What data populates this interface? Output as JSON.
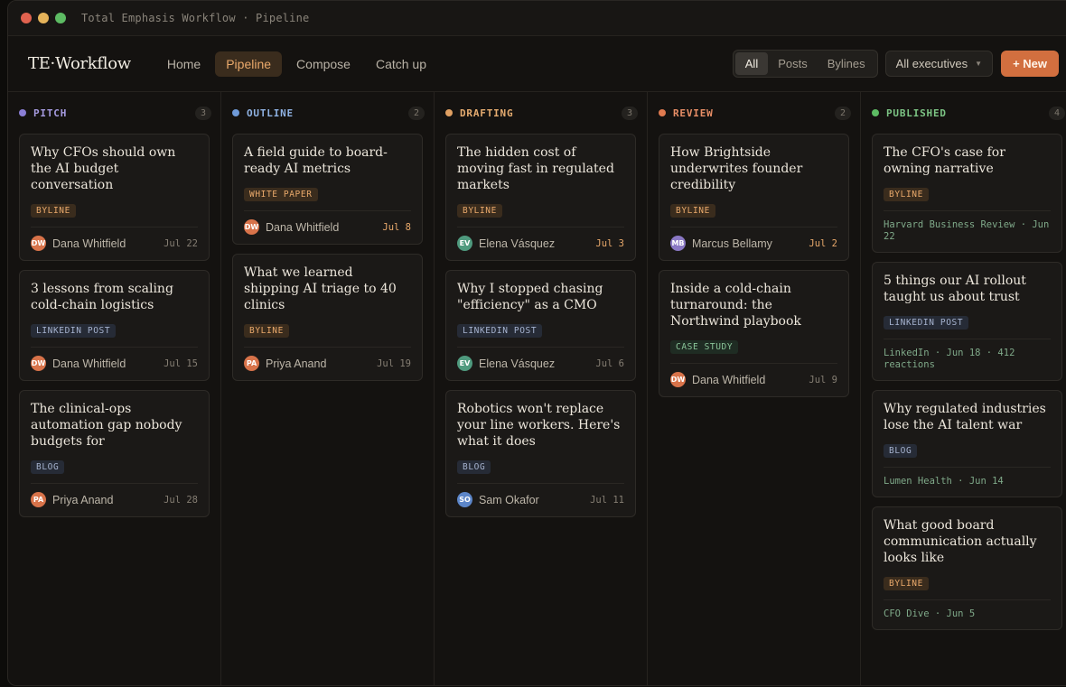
{
  "window": {
    "title": "Total Emphasis Workflow · Pipeline"
  },
  "header": {
    "logo": "TE·Workflow",
    "nav": [
      {
        "label": "Home",
        "active": false
      },
      {
        "label": "Pipeline",
        "active": true
      },
      {
        "label": "Compose",
        "active": false
      },
      {
        "label": "Catch up",
        "active": false
      }
    ],
    "filter": [
      {
        "label": "All",
        "active": true
      },
      {
        "label": "Posts",
        "active": false
      },
      {
        "label": "Bylines",
        "active": false
      }
    ],
    "executive_select": "All executives",
    "new_button": "+ New"
  },
  "colors": {
    "accent": "#d26f3f",
    "pitch": "#8b7fd6",
    "outline": "#6f9ad8",
    "drafting": "#e0a062",
    "review": "#e07a4f",
    "published": "#5dbb63"
  },
  "columns": [
    {
      "name": "PITCH",
      "count": "3",
      "dot": "#8b7fd6",
      "text_color": "#a69be0",
      "cards": [
        {
          "title": "Why CFOs should own the AI budget conversation",
          "tag": "BYLINE",
          "tag_type": "byline",
          "initials": "DW",
          "avatar": "#d8734a",
          "author": "Dana Whitfield",
          "date": "Jul 22",
          "soon": false
        },
        {
          "title": "3 lessons from scaling cold-chain logistics",
          "tag": "LINKEDIN POST",
          "tag_type": "linkedin",
          "initials": "DW",
          "avatar": "#d8734a",
          "author": "Dana Whitfield",
          "date": "Jul 15",
          "soon": false
        },
        {
          "title": "The clinical-ops automation gap nobody budgets for",
          "tag": "BLOG",
          "tag_type": "blog",
          "initials": "PA",
          "avatar": "#d8734a",
          "author": "Priya Anand",
          "date": "Jul 28",
          "soon": false
        }
      ]
    },
    {
      "name": "OUTLINE",
      "count": "2",
      "dot": "#6f9ad8",
      "text_color": "#8fb2e3",
      "cards": [
        {
          "title": "A field guide to board-ready AI metrics",
          "tag": "WHITE PAPER",
          "tag_type": "whitepaper",
          "initials": "DW",
          "avatar": "#d8734a",
          "author": "Dana Whitfield",
          "date": "Jul 8",
          "soon": true
        },
        {
          "title": "What we learned shipping AI triage to 40 clinics",
          "tag": "BYLINE",
          "tag_type": "byline",
          "initials": "PA",
          "avatar": "#d8734a",
          "author": "Priya Anand",
          "date": "Jul 19",
          "soon": false
        }
      ]
    },
    {
      "name": "DRAFTING",
      "count": "3",
      "dot": "#e0a062",
      "text_color": "#e6ac70",
      "cards": [
        {
          "title": "The hidden cost of moving fast in regulated markets",
          "tag": "BYLINE",
          "tag_type": "byline",
          "initials": "EV",
          "avatar": "#4f9a7e",
          "author": "Elena Vásquez",
          "date": "Jul 3",
          "soon": true
        },
        {
          "title": "Why I stopped chasing \"efficiency\" as a CMO",
          "tag": "LINKEDIN POST",
          "tag_type": "linkedin",
          "initials": "EV",
          "avatar": "#4f9a7e",
          "author": "Elena Vásquez",
          "date": "Jul 6",
          "soon": false
        },
        {
          "title": "Robotics won't replace your line workers. Here's what it does",
          "tag": "BLOG",
          "tag_type": "blog",
          "initials": "SO",
          "avatar": "#5c86c9",
          "author": "Sam Okafor",
          "date": "Jul 11",
          "soon": false
        }
      ]
    },
    {
      "name": "REVIEW",
      "count": "2",
      "dot": "#e07a4f",
      "text_color": "#e88e66",
      "cards": [
        {
          "title": "How Brightside underwrites founder credibility",
          "tag": "BYLINE",
          "tag_type": "byline",
          "initials": "MB",
          "avatar": "#8a78c4",
          "author": "Marcus Bellamy",
          "date": "Jul 2",
          "soon": true
        },
        {
          "title": "Inside a cold-chain turnaround: the Northwind playbook",
          "tag": "CASE STUDY",
          "tag_type": "casestudy",
          "initials": "DW",
          "avatar": "#d8734a",
          "author": "Dana Whitfield",
          "date": "Jul 9",
          "soon": false
        }
      ]
    },
    {
      "name": "PUBLISHED",
      "count": "4",
      "dot": "#5dbb63",
      "text_color": "#7cc484",
      "cards": [
        {
          "title": "The CFO's case for owning narrative",
          "tag": "BYLINE",
          "tag_type": "byline",
          "meta": "Harvard Business Review · Jun 22"
        },
        {
          "title": "5 things our AI rollout taught us about trust",
          "tag": "LINKEDIN POST",
          "tag_type": "linkedin",
          "meta": "LinkedIn · Jun 18 · 412 reactions"
        },
        {
          "title": "Why regulated industries lose the AI talent war",
          "tag": "BLOG",
          "tag_type": "blog",
          "meta": "Lumen Health · Jun 14"
        },
        {
          "title": "What good board communication actually looks like",
          "tag": "BYLINE",
          "tag_type": "byline",
          "meta": "CFO Dive · Jun 5"
        }
      ]
    }
  ]
}
